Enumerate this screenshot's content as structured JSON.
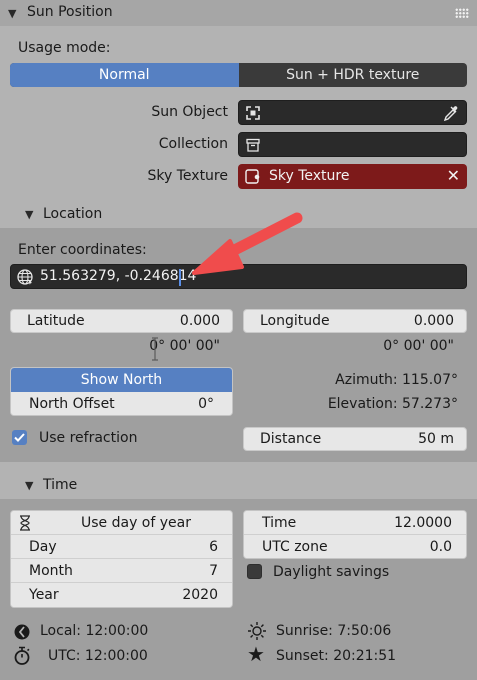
{
  "panel": {
    "title": "Sun Position"
  },
  "usage": {
    "label": "Usage mode:",
    "options": [
      "Normal",
      "Sun + HDR texture"
    ],
    "selected": "Normal"
  },
  "props": {
    "sun_object_label": "Sun Object",
    "collection_label": "Collection",
    "sky_texture_label": "Sky Texture",
    "sky_texture_value": "Sky Texture"
  },
  "location": {
    "header": "Location",
    "enter_label": "Enter coordinates:",
    "coords_value": "51.563279, -0.246814",
    "latitude_label": "Latitude",
    "latitude_value": "0.000",
    "latitude_dms": "0° 00' 00\"",
    "longitude_label": "Longitude",
    "longitude_value": "0.000",
    "longitude_dms": "0° 00' 00\"",
    "show_north": "Show North",
    "north_offset_label": "North Offset",
    "north_offset_value": "0°",
    "azimuth": "Azimuth: 115.07°",
    "elevation": "Elevation: 57.273°",
    "use_refraction": "Use refraction",
    "use_refraction_checked": true,
    "distance_label": "Distance",
    "distance_value": "50 m"
  },
  "time": {
    "header": "Time",
    "use_day_of_year": "Use day of year",
    "day_label": "Day",
    "day_value": "6",
    "month_label": "Month",
    "month_value": "7",
    "year_label": "Year",
    "year_value": "2020",
    "time_label": "Time",
    "time_value": "12.0000",
    "utc_zone_label": "UTC zone",
    "utc_zone_value": "0.0",
    "daylight_savings": "Daylight savings",
    "daylight_savings_checked": false,
    "local": "Local: 12:00:00",
    "utc": "UTC: 12:00:00",
    "sunrise": "Sunrise: 7:50:06",
    "sunset": "Sunset: 20:21:51"
  },
  "colors": {
    "accent_blue": "#5680c2",
    "sky_texture_red": "#7d1a1a",
    "arrow_red": "#f04c4c"
  }
}
